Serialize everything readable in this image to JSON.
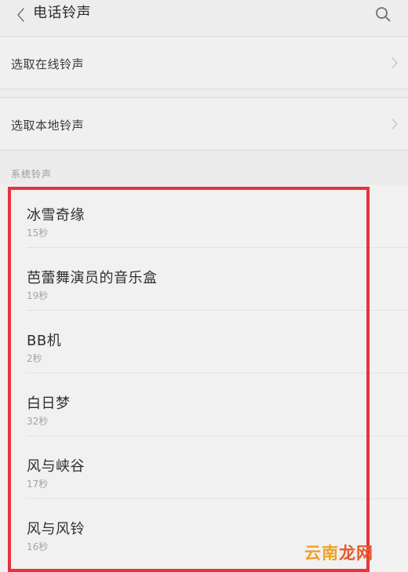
{
  "header": {
    "title": "电话铃声"
  },
  "options": {
    "online_label": "选取在线铃声",
    "local_label": "选取本地铃声"
  },
  "section": {
    "title": "系统铃声"
  },
  "ringtones": [
    {
      "name": "冰雪奇缘",
      "duration": "15秒"
    },
    {
      "name": "芭蕾舞演员的音乐盒",
      "duration": "19秒"
    },
    {
      "name": "BB机",
      "duration": "2秒"
    },
    {
      "name": "白日梦",
      "duration": "32秒"
    },
    {
      "name": "风与峡谷",
      "duration": "17秒"
    },
    {
      "name": "风与风铃",
      "duration": "16秒"
    }
  ],
  "watermark": {
    "part1": "云南",
    "part2": "龙网"
  },
  "colors": {
    "highlight": "#e8333b",
    "watermark_orange": "#f0a020",
    "watermark_red": "#e8572a"
  }
}
